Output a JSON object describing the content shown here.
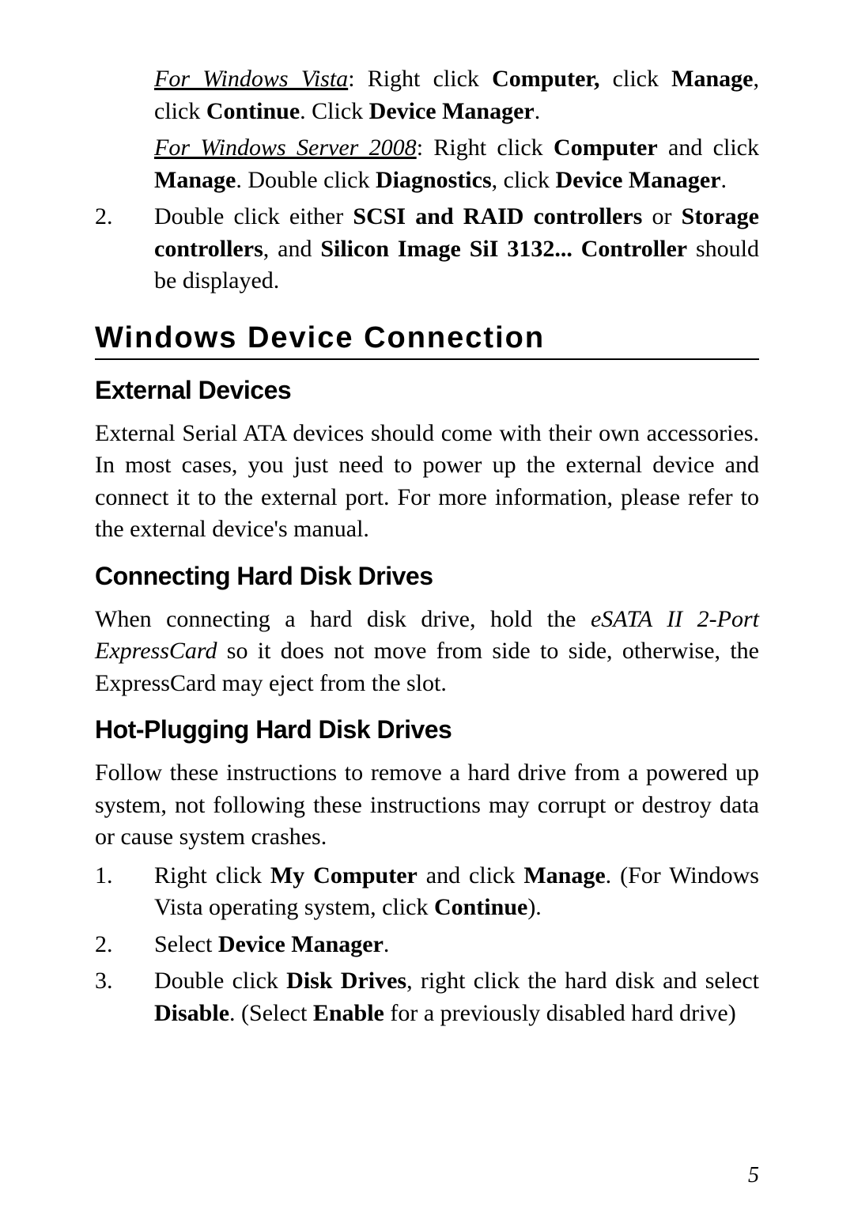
{
  "paragraphs": {
    "vista": {
      "prefix": "For Windows Vista",
      "text": ": Right click ",
      "b1": "Computer,",
      "t2": " click ",
      "b2": "Manage",
      "t3": ", click ",
      "b3": "Continue",
      "t4": ". Click ",
      "b4": "Device Manager",
      "t5": "."
    },
    "server2008": {
      "prefix": "For Windows Server 2008",
      "t1": ": Right click ",
      "b1": "Computer",
      "t2": " and click ",
      "b2": "Manage",
      "t3": ".  Double click ",
      "b3": "Diagnostics",
      "t4": ", click ",
      "b4": "Device Manager",
      "t5": "."
    },
    "step2": {
      "num": "2.",
      "t1": "Double click either ",
      "b1": "SCSI and RAID controllers",
      "t2": " or ",
      "b2": "Storage controllers",
      "t3": ", and ",
      "b3": "Silicon Image SiI 3132... Controller",
      "t4": " should be displayed."
    }
  },
  "section1": {
    "title": "Windows  Device  Connection",
    "sub1": {
      "title": "External Devices",
      "body": "External Serial ATA devices should come with their own accessories.  In most cases, you just need to power up the external device and connect it to the external port.  For more information, please refer to the external device's manual."
    },
    "sub2": {
      "title": "Connecting Hard Disk Drives",
      "t1": "When connecting a hard disk drive, hold the ",
      "i1": "eSATA II 2-Port ExpressCard",
      "t2": " so it does not move from side to side, otherwise, the ExpressCard may eject from the slot."
    },
    "sub3": {
      "title": "Hot-Plugging Hard Disk Drives",
      "intro": "Follow these instructions to remove a hard drive from a powered up system, not following these instructions may corrupt or destroy data or cause system crashes.",
      "step1": {
        "num": "1.",
        "t1": "Right click ",
        "b1": "My Computer",
        "t2": " and click ",
        "b2": "Manage",
        "t3": ".  (For Windows Vista operating system, click ",
        "b3": "Continue",
        "t4": ")."
      },
      "step2": {
        "num": "2.",
        "t1": "Select ",
        "b1": "Device Manager",
        "t2": "."
      },
      "step3": {
        "num": "3.",
        "t1": "Double click ",
        "b1": "Disk Drives",
        "t2": ", right click the hard disk and select ",
        "b2": "Disable",
        "t3": ". (Select ",
        "b3": "Enable",
        "t4": " for a previously disabled hard drive)"
      }
    }
  },
  "pageNumber": "5"
}
